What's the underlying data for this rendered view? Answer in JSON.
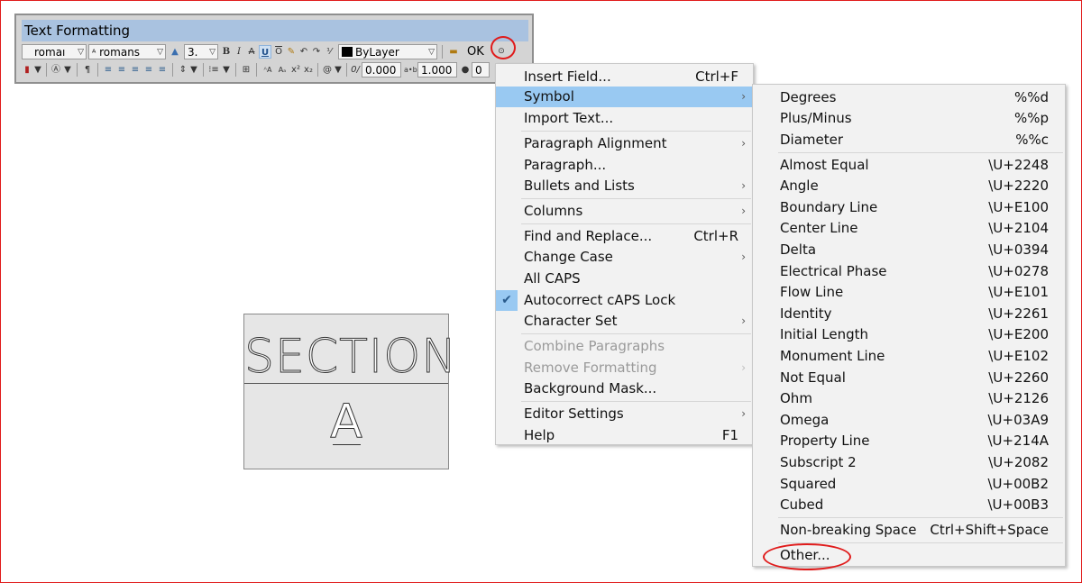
{
  "toolbar": {
    "title": "Text Formatting",
    "style_value": "romaı",
    "font_value": "romans",
    "height_value": "3.",
    "color_value": "ByLayer",
    "ok_label": "OK",
    "oblique_value": "0.000",
    "tracking_value": "1.000",
    "width_value": "0"
  },
  "drawing": {
    "section_text": "SECTION",
    "letter_text": "A"
  },
  "context_menu": {
    "items": [
      {
        "label": "Insert Field...",
        "shortcut": "Ctrl+F"
      },
      {
        "label": "Symbol",
        "submenu": "›"
      },
      {
        "label": "Import Text..."
      },
      {
        "label": "Paragraph Alignment",
        "submenu": "›"
      },
      {
        "label": "Paragraph..."
      },
      {
        "label": "Bullets and Lists",
        "submenu": "›"
      },
      {
        "label": "Columns",
        "submenu": "›"
      },
      {
        "label": "Find and Replace...",
        "shortcut": "Ctrl+R"
      },
      {
        "label": "Change Case",
        "submenu": "›"
      },
      {
        "label": "All CAPS"
      },
      {
        "label": "Autocorrect cAPS Lock",
        "checked": "✔"
      },
      {
        "label": "Character Set",
        "submenu": "›"
      },
      {
        "label": "Combine Paragraphs"
      },
      {
        "label": "Remove Formatting",
        "submenu": "›"
      },
      {
        "label": "Background Mask..."
      },
      {
        "label": "Editor Settings",
        "submenu": "›"
      },
      {
        "label": "Help",
        "shortcut": "F1"
      }
    ]
  },
  "symbol_menu": {
    "items": [
      {
        "label": "Degrees",
        "code": "%%d"
      },
      {
        "label": "Plus/Minus",
        "code": "%%p"
      },
      {
        "label": "Diameter",
        "code": "%%c"
      },
      {
        "label": "Almost Equal",
        "code": "\\U+2248"
      },
      {
        "label": "Angle",
        "code": "\\U+2220"
      },
      {
        "label": "Boundary Line",
        "code": "\\U+E100"
      },
      {
        "label": "Center Line",
        "code": "\\U+2104"
      },
      {
        "label": "Delta",
        "code": "\\U+0394"
      },
      {
        "label": "Electrical Phase",
        "code": "\\U+0278"
      },
      {
        "label": "Flow Line",
        "code": "\\U+E101"
      },
      {
        "label": "Identity",
        "code": "\\U+2261"
      },
      {
        "label": "Initial Length",
        "code": "\\U+E200"
      },
      {
        "label": "Monument Line",
        "code": "\\U+E102"
      },
      {
        "label": "Not Equal",
        "code": "\\U+2260"
      },
      {
        "label": "Ohm",
        "code": "\\U+2126"
      },
      {
        "label": "Omega",
        "code": "\\U+03A9"
      },
      {
        "label": "Property Line",
        "code": "\\U+214A"
      },
      {
        "label": "Subscript 2",
        "code": "\\U+2082"
      },
      {
        "label": "Squared",
        "code": "\\U+00B2"
      },
      {
        "label": "Cubed",
        "code": "\\U+00B3"
      },
      {
        "label": "Non-breaking Space",
        "code": "Ctrl+Shift+Space"
      },
      {
        "label": "Other..."
      }
    ]
  },
  "colors": {
    "highlight": "#99c9f2",
    "annotation_red": "#e01b1b",
    "title_bar": "#a9c2e0"
  }
}
